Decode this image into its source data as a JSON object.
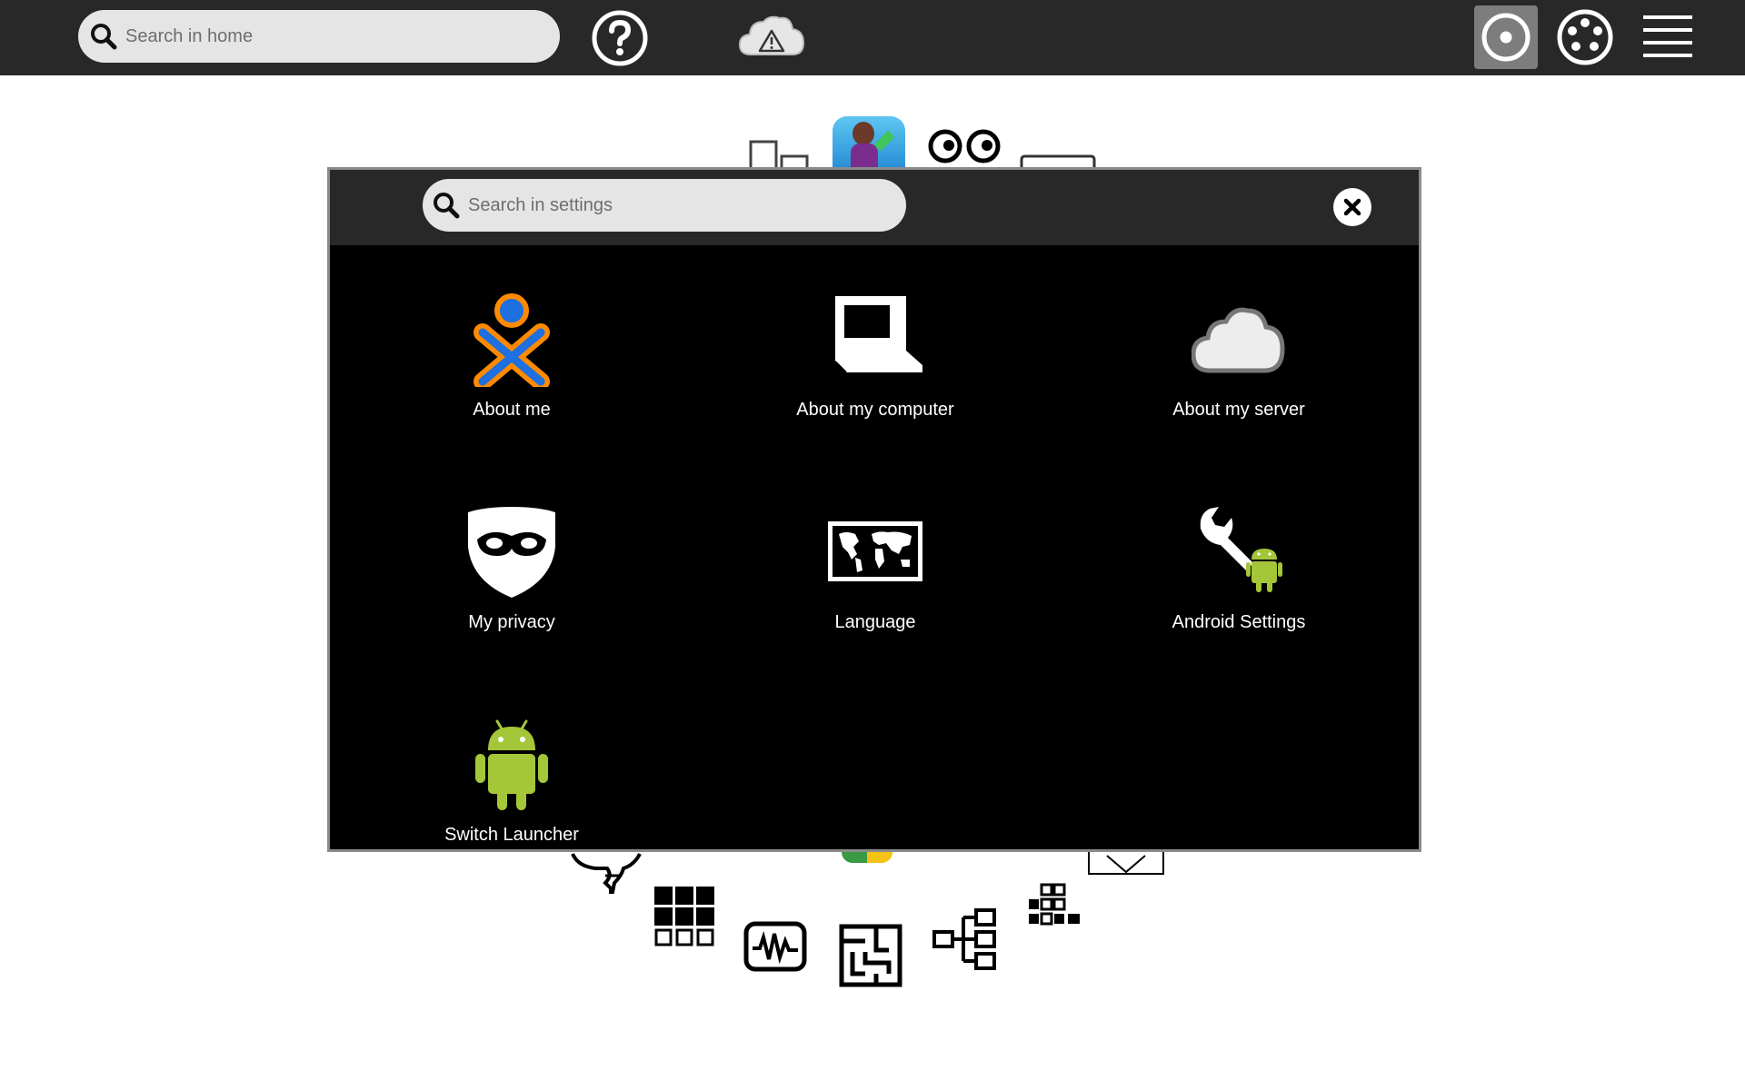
{
  "toolbar": {
    "search_placeholder": "Search in home",
    "icons": [
      "search-icon",
      "help-icon",
      "cloud-warning-icon",
      "home-view-icon",
      "neighborhood-view-icon",
      "list-view-icon"
    ]
  },
  "settings": {
    "search_placeholder": "Search in settings",
    "close_icon": "close-icon",
    "items": [
      {
        "label": "About me",
        "icon": "xo-person-icon"
      },
      {
        "label": "About my computer",
        "icon": "laptop-icon"
      },
      {
        "label": "About my server",
        "icon": "cloud-icon"
      },
      {
        "label": "My privacy",
        "icon": "privacy-mask-icon"
      },
      {
        "label": "Language",
        "icon": "world-map-icon"
      },
      {
        "label": "Android Settings",
        "icon": "wrench-android-icon"
      },
      {
        "label": "Switch Launcher",
        "icon": "android-icon"
      }
    ]
  },
  "colors": {
    "toolbar_bg": "#282828",
    "modal_bg": "#000000",
    "xo_orange": "#ff8a00",
    "xo_blue": "#1e6fe0",
    "android_green": "#a4c639"
  }
}
